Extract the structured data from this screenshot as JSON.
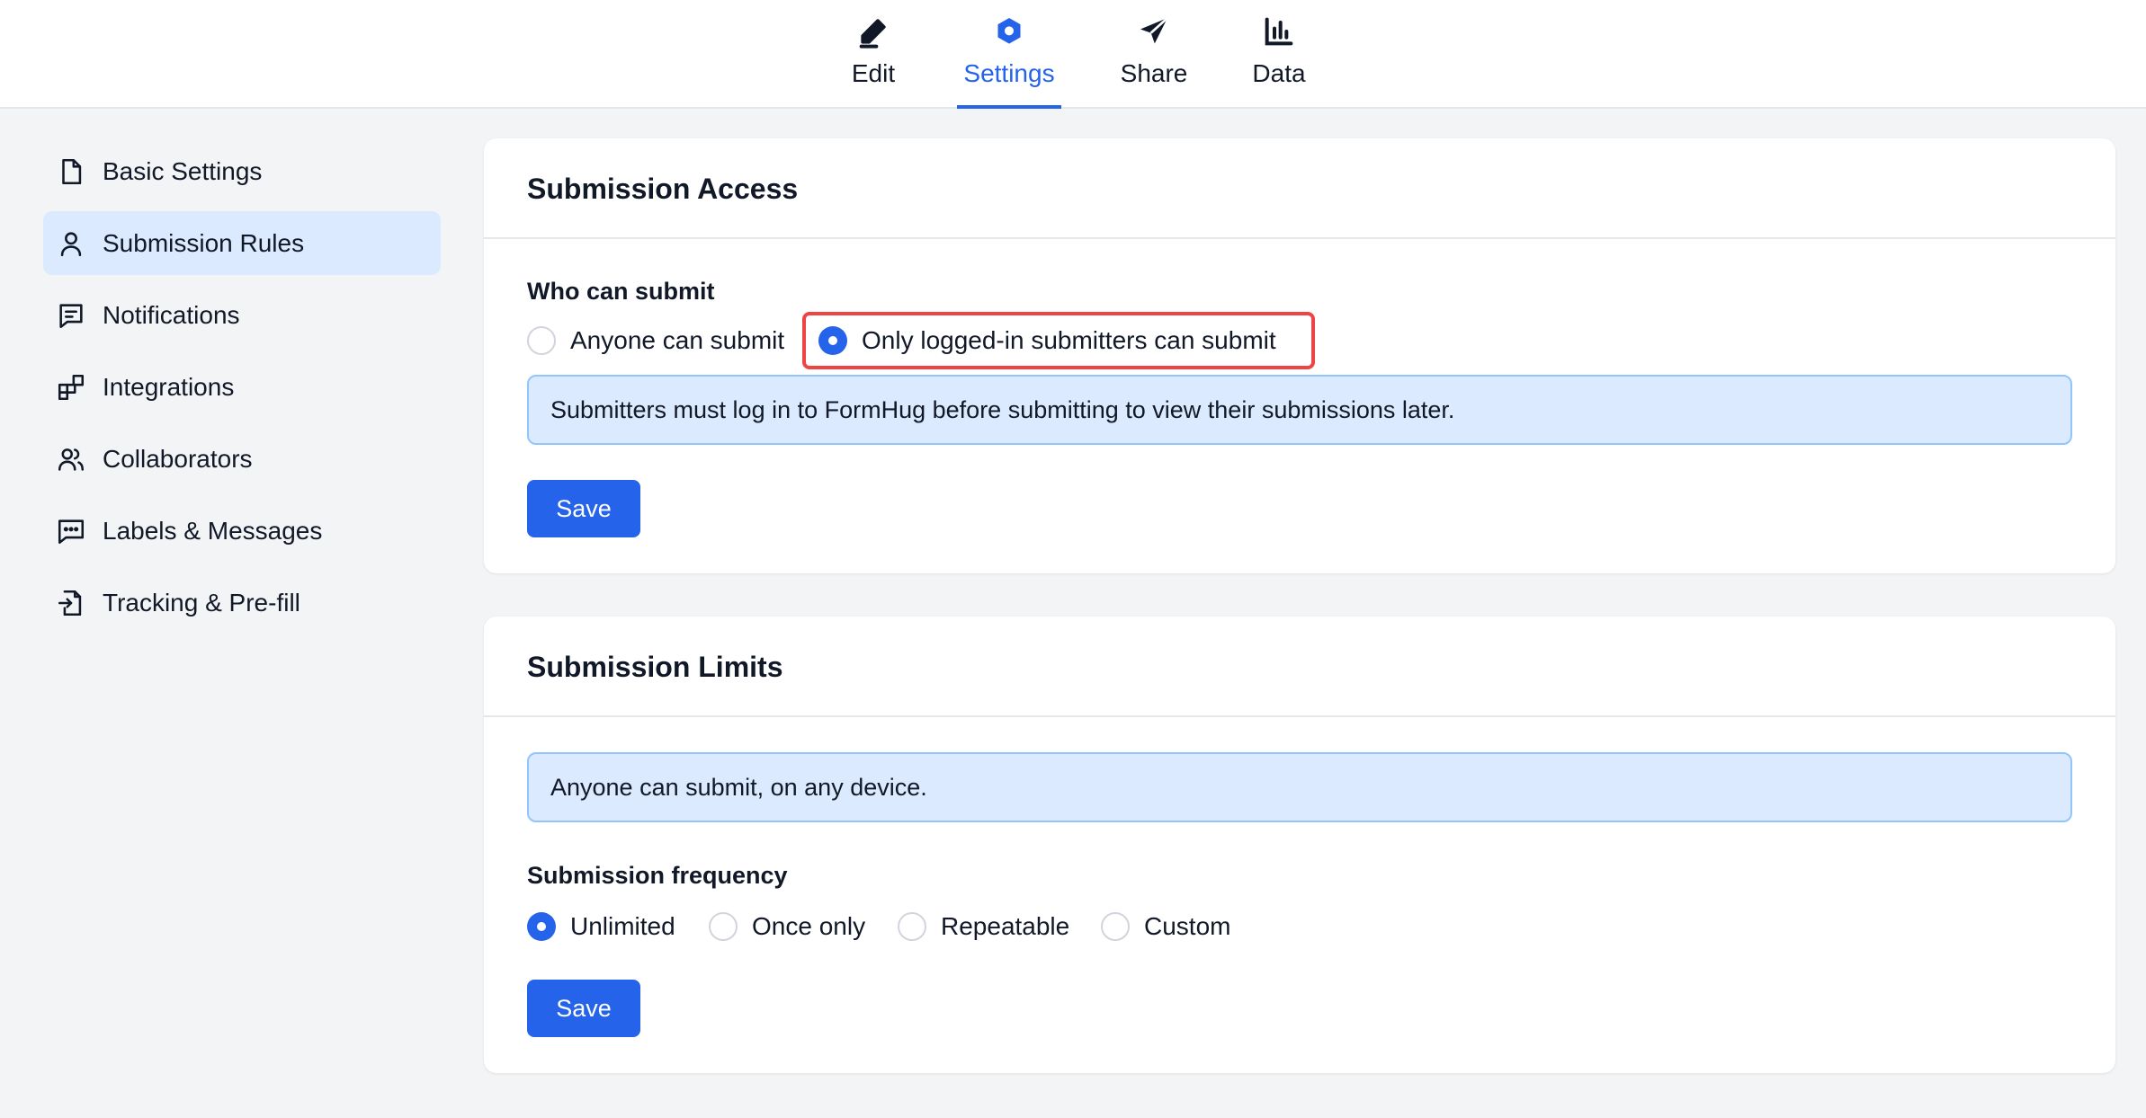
{
  "top_nav": {
    "tabs": [
      {
        "label": "Edit",
        "icon": "pencil-icon"
      },
      {
        "label": "Settings",
        "icon": "hexagon-gear-icon",
        "active": true
      },
      {
        "label": "Share",
        "icon": "paper-plane-icon"
      },
      {
        "label": "Data",
        "icon": "bar-chart-icon"
      }
    ]
  },
  "sidebar": {
    "items": [
      {
        "label": "Basic Settings",
        "icon": "document-icon"
      },
      {
        "label": "Submission Rules",
        "icon": "user-icon",
        "active": true
      },
      {
        "label": "Notifications",
        "icon": "message-lines-icon"
      },
      {
        "label": "Integrations",
        "icon": "puzzle-blocks-icon"
      },
      {
        "label": "Collaborators",
        "icon": "users-icon"
      },
      {
        "label": "Labels & Messages",
        "icon": "chat-dots-icon"
      },
      {
        "label": "Tracking & Pre-fill",
        "icon": "file-import-icon"
      }
    ]
  },
  "submission_access": {
    "title": "Submission Access",
    "field_label": "Who can submit",
    "options": [
      {
        "label": "Anyone can submit",
        "checked": false
      },
      {
        "label": "Only logged-in submitters can submit",
        "checked": true
      }
    ],
    "info": "Submitters must log in to FormHug before submitting to view their submissions later.",
    "save_label": "Save"
  },
  "submission_limits": {
    "title": "Submission Limits",
    "info": "Anyone can submit, on any device.",
    "field_label": "Submission frequency",
    "options": [
      {
        "label": "Unlimited",
        "checked": true
      },
      {
        "label": "Once only",
        "checked": false
      },
      {
        "label": "Repeatable",
        "checked": false
      },
      {
        "label": "Custom",
        "checked": false
      }
    ],
    "save_label": "Save"
  },
  "colors": {
    "accent": "#2563eb",
    "active_bg": "#dbeafe",
    "highlight": "#ef4444"
  }
}
